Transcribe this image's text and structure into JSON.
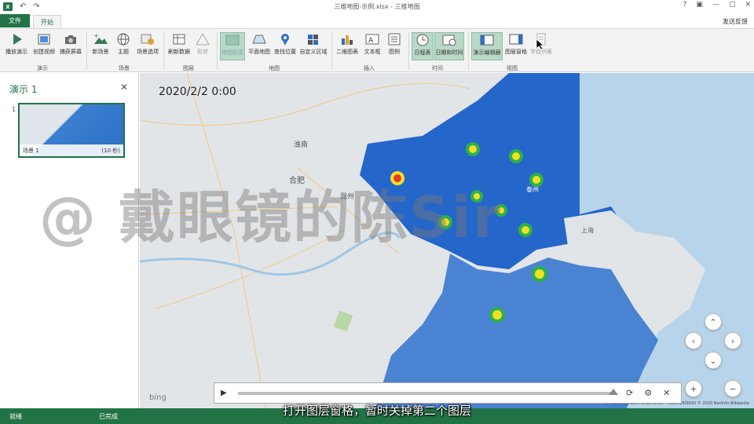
{
  "window": {
    "title": "三维地图-示例.xlsx - 三维地图",
    "app_icon_letter": "X",
    "undo": "↶",
    "redo": "↷",
    "controls": [
      "?",
      "▣",
      "—",
      "▢",
      "✕"
    ]
  },
  "tabs": {
    "file": "文件",
    "home": "开始",
    "feedback": "发送反馈"
  },
  "ribbon": {
    "buttons": {
      "play_tour": "播放演示",
      "create_video": "创建视频",
      "capture_screen": "捕获屏幕",
      "new_scene": "新场景",
      "theme": "主题",
      "scene_options": "场景选项",
      "refresh_data": "刷新数据",
      "shapes": "形状",
      "flat_map": "平面地图",
      "find_location": "查找位置",
      "custom_regions": "自定义区域",
      "map_labels": "地图标签",
      "chart_2d": "二维图表",
      "text_box": "文本框",
      "legend": "图例",
      "timeline": "日程表",
      "date_time": "日期和时间",
      "tour_editor": "演示编辑器",
      "layer_pane": "图层窗格",
      "field_list": "字段列表"
    },
    "groups": {
      "tour": "演示",
      "scene": "场景",
      "layer": "图层",
      "map": "地图",
      "insert": "插入",
      "time": "时间",
      "view": "视图"
    }
  },
  "tour_pane": {
    "title": "演示 1",
    "close": "✕",
    "scenes": [
      {
        "number": "1",
        "name": "场景 1",
        "duration": "(10 秒)"
      }
    ]
  },
  "map": {
    "timestamp": "2020/2/2 0:00",
    "attribution": "© 2020 Microsoft Corporation - GS(2018)6920  © 2020 NavInfo  Wikipedia",
    "bing_label": "bing",
    "labels": [
      "淮南",
      "滁州",
      "合肥",
      "泰州",
      "上海"
    ],
    "nav": {
      "up": "⌃",
      "down": "⌄",
      "left": "‹",
      "right": "›",
      "zoom_in": "+",
      "zoom_out": "−"
    },
    "region_colors": {
      "jiangsu": "#1a5fc8",
      "zhejiang": "#2f72cc",
      "land": "#e2e5e8",
      "sea": "#b8d4ea"
    }
  },
  "player": {
    "play": "▶",
    "refresh": "⟳",
    "settings": "⚙",
    "close": "✕"
  },
  "status": {
    "left": "就绪",
    "middle": "已完成"
  },
  "overlay": {
    "watermark": "@ 戴眼镜的陈Sir",
    "subtitle": "打开图层窗格，暂时关掉第二个图层"
  }
}
